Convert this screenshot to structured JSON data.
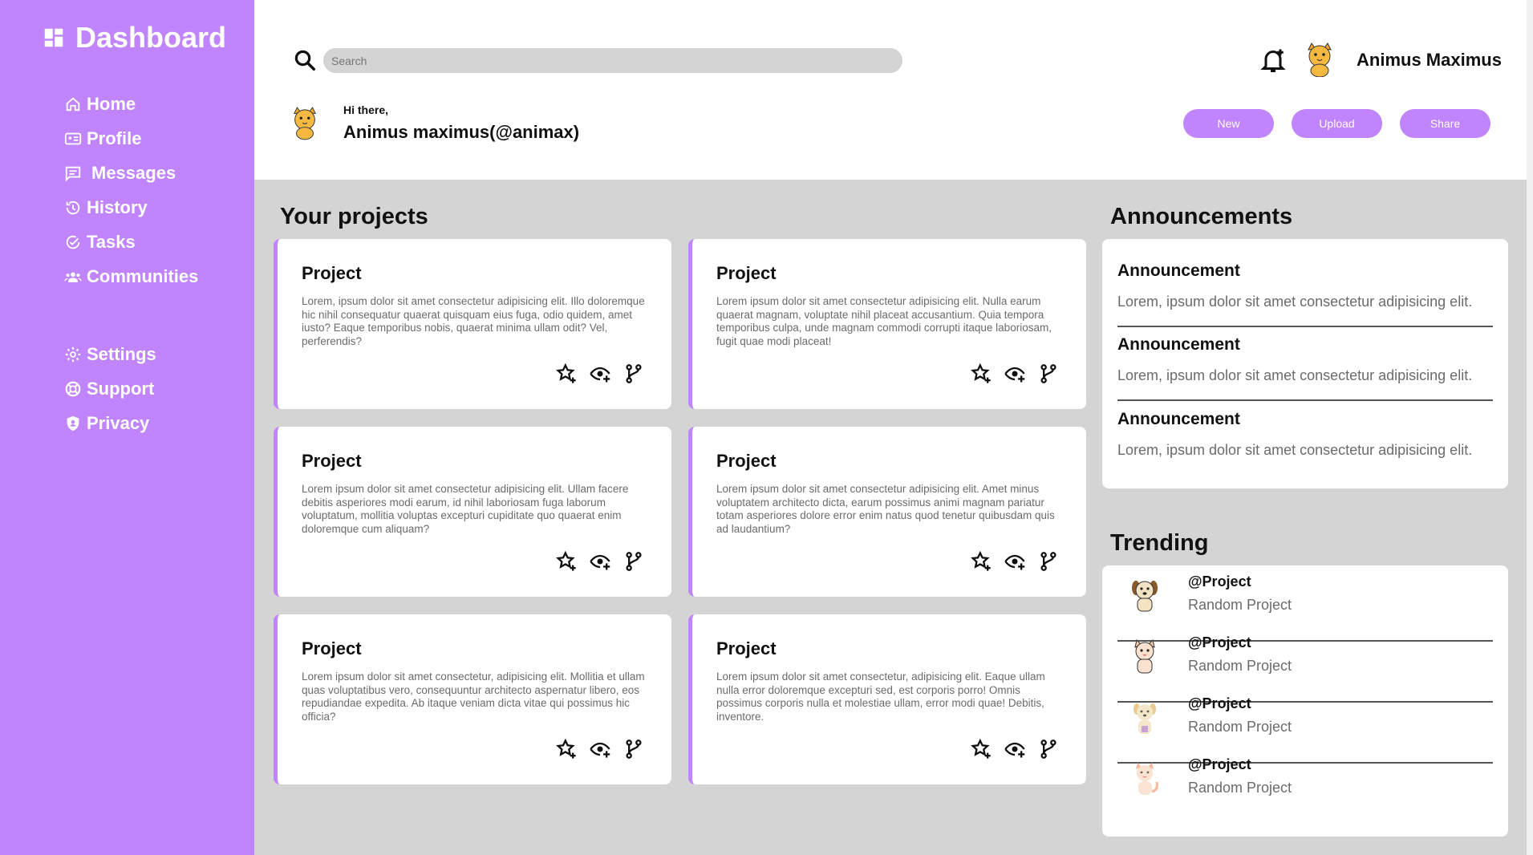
{
  "sidebar": {
    "brand": "Dashboard",
    "nav": [
      {
        "label": "Home",
        "icon": "home-icon"
      },
      {
        "label": "Profile",
        "icon": "id-card-icon"
      },
      {
        "label": "Messages",
        "icon": "message-icon"
      },
      {
        "label": "History",
        "icon": "history-icon"
      },
      {
        "label": "Tasks",
        "icon": "tasks-icon"
      },
      {
        "label": "Communities",
        "icon": "users-icon"
      }
    ],
    "nav2": [
      {
        "label": "Settings",
        "icon": "gear-icon"
      },
      {
        "label": "Support",
        "icon": "lifebuoy-icon"
      },
      {
        "label": "Privacy",
        "icon": "shield-icon"
      }
    ]
  },
  "header": {
    "search_placeholder": "Search",
    "user_name": "Animus Maximus",
    "greeting": "Hi there,",
    "handle_line": "Animus maximus(@animax)",
    "buttons": {
      "new": "New",
      "upload": "Upload",
      "share": "Share"
    }
  },
  "projects": {
    "title": "Your projects",
    "items": [
      {
        "title": "Project",
        "desc": "Lorem, ipsum dolor sit amet consectetur adipisicing elit. Illo doloremque hic nihil consequatur quaerat quisquam eius fuga, odio quidem, amet iusto? Eaque temporibus nobis, quaerat minima ullam odit? Vel, perferendis?"
      },
      {
        "title": "Project",
        "desc": "Lorem ipsum dolor sit amet consectetur adipisicing elit. Nulla earum quaerat magnam, voluptate nihil placeat accusantium. Quia tempora temporibus culpa, unde magnam commodi corrupti itaque laboriosam, fugit quae modi placeat!"
      },
      {
        "title": "Project",
        "desc": "Lorem ipsum dolor sit amet consectetur adipisicing elit. Ullam facere debitis asperiores modi earum, id nihil laboriosam fuga laborum voluptatum, mollitia voluptas excepturi cupiditate quo quaerat enim doloremque cum aliquam?"
      },
      {
        "title": "Project",
        "desc": "Lorem ipsum dolor sit amet consectetur adipisicing elit. Amet minus voluptatem architecto dicta, earum possimus animi magnam pariatur totam asperiores dolore error enim natus quod tenetur quibusdam quis ad laudantium?"
      },
      {
        "title": "Project",
        "desc": "Lorem ipsum dolor sit amet consectetur, adipisicing elit. Mollitia et ullam quas voluptatibus vero, consequuntur architecto aspernatur libero, eos repudiandae expedita. Ab itaque veniam dicta vitae qui possimus hic officia?"
      },
      {
        "title": "Project",
        "desc": "Lorem ipsum dolor sit amet consectetur, adipisicing elit. Eaque ullam nulla error doloremque excepturi sed, est corporis porro! Omnis possimus corporis nulla et molestiae ullam, error modi quae! Debitis, inventore."
      }
    ]
  },
  "announcements": {
    "title": "Announcements",
    "items": [
      {
        "title": "Announcement",
        "text": "Lorem, ipsum dolor sit amet consectetur adipisicing elit."
      },
      {
        "title": "Announcement",
        "text": "Lorem, ipsum dolor sit amet consectetur adipisicing elit."
      },
      {
        "title": "Announcement",
        "text": "Lorem, ipsum dolor sit amet consectetur adipisicing elit."
      }
    ]
  },
  "trending": {
    "title": "Trending",
    "items": [
      {
        "handle": "@Project",
        "name": "Random Project"
      },
      {
        "handle": "@Project",
        "name": "Random Project"
      },
      {
        "handle": "@Project",
        "name": "Random Project"
      },
      {
        "handle": "@Project",
        "name": "Random Project"
      }
    ]
  },
  "colors": {
    "accent": "#c084fc",
    "background": "#d4d4d4"
  }
}
